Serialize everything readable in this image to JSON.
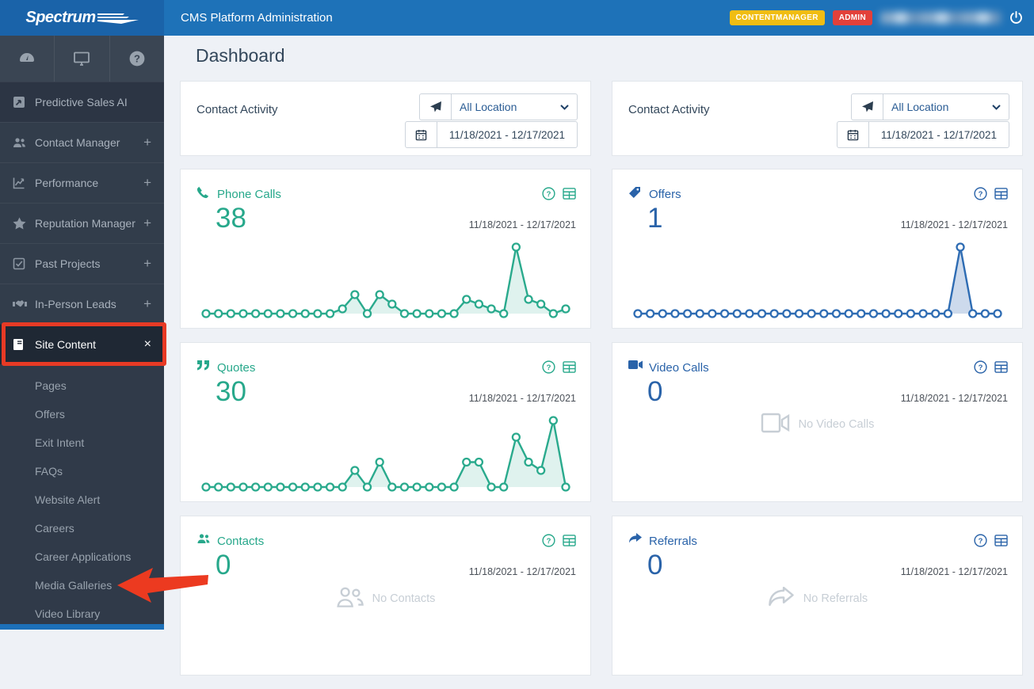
{
  "topbar": {
    "brand": "Spectrum",
    "title": "CMS Platform Administration",
    "badges": [
      {
        "label": "CONTENTMANAGER",
        "bg": "#f0bd13"
      },
      {
        "label": "ADMIN",
        "bg": "#e2403a"
      }
    ]
  },
  "sidebar": {
    "top_icons": [
      "tachometer",
      "desktop",
      "help"
    ],
    "items": [
      {
        "label": "Predictive Sales AI"
      },
      {
        "label": "Contact Manager",
        "expand": "+"
      },
      {
        "label": "Performance",
        "expand": "+"
      },
      {
        "label": "Reputation Manager",
        "expand": "+"
      },
      {
        "label": "Past Projects",
        "expand": "+"
      },
      {
        "label": "In-Person Leads",
        "expand": "+"
      },
      {
        "label": "Site Content",
        "close": "×",
        "active": true
      }
    ],
    "subitems": [
      "Pages",
      "Offers",
      "Exit Intent",
      "FAQs",
      "Website Alert",
      "Careers",
      "Career Applications",
      "Media Galleries",
      "Video Library"
    ]
  },
  "main": {
    "page_title": "Dashboard"
  },
  "panels": [
    {
      "title": "Contact Activity",
      "location": "All Location",
      "date_range": "11/18/2021 - 12/17/2021"
    },
    {
      "title": "Contact Activity",
      "location": "All Location",
      "date_range": "11/18/2021 - 12/17/2021"
    }
  ],
  "cards": [
    {
      "title": "Phone Calls",
      "value": "38",
      "date_range": "11/18/2021 - 12/17/2021",
      "accent": "#27a88b"
    },
    {
      "title": "Offers",
      "value": "1",
      "date_range": "11/18/2021 - 12/17/2021",
      "accent": "#2a63a9"
    },
    {
      "title": "Quotes",
      "value": "30",
      "date_range": "11/18/2021 - 12/17/2021",
      "accent": "#27a88b"
    },
    {
      "title": "Video Calls",
      "value": "0",
      "date_range": "11/18/2021 - 12/17/2021",
      "accent": "#2a63a9",
      "empty_text": "No Video Calls"
    },
    {
      "title": "Contacts",
      "value": "0",
      "date_range": "11/18/2021 - 12/17/2021",
      "accent": "#27a88b",
      "empty_text": "No Contacts"
    },
    {
      "title": "Referrals",
      "value": "0",
      "date_range": "11/18/2021 - 12/17/2021",
      "accent": "#2a63a9",
      "empty_text": "No Referrals"
    }
  ],
  "chart_data": [
    {
      "type": "line",
      "name": "Phone Calls",
      "x_start": "11/18/2021",
      "x_end": "12/17/2021",
      "values": [
        0,
        0,
        0,
        0,
        0,
        0,
        0,
        0,
        0,
        0,
        0,
        1,
        4,
        0,
        4,
        2,
        0,
        0,
        0,
        0,
        0,
        3,
        2,
        1,
        0,
        14,
        3,
        2,
        0,
        1
      ],
      "color": "#2aaa8d",
      "fill": "rgba(42,170,141,0.15)",
      "ylim": [
        0,
        14
      ],
      "grid": false,
      "legend": "none"
    },
    {
      "type": "line",
      "name": "Offers",
      "x_start": "11/18/2021",
      "x_end": "12/17/2021",
      "values": [
        0,
        0,
        0,
        0,
        0,
        0,
        0,
        0,
        0,
        0,
        0,
        0,
        0,
        0,
        0,
        0,
        0,
        0,
        0,
        0,
        0,
        0,
        0,
        0,
        0,
        0,
        1,
        0,
        0,
        0
      ],
      "color": "#2e6cb3",
      "fill": "rgba(88,134,193,0.3)",
      "ylim": [
        0,
        1
      ],
      "grid": false,
      "legend": "none"
    },
    {
      "type": "line",
      "name": "Quotes",
      "x_start": "11/18/2021",
      "x_end": "12/17/2021",
      "values": [
        0,
        0,
        0,
        0,
        0,
        0,
        0,
        0,
        0,
        0,
        0,
        0,
        2,
        0,
        3,
        0,
        0,
        0,
        0,
        0,
        0,
        3,
        3,
        0,
        0,
        6,
        3,
        2,
        8,
        0
      ],
      "color": "#2aaa8d",
      "fill": "rgba(42,170,141,0.15)",
      "ylim": [
        0,
        8
      ],
      "grid": false,
      "legend": "none"
    }
  ]
}
